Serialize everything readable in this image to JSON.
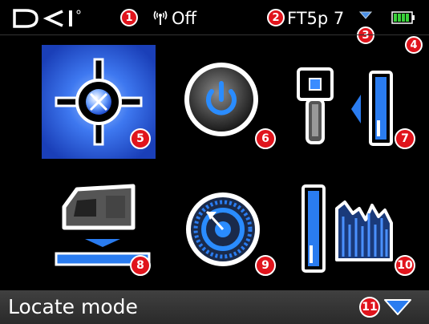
{
  "status": {
    "brand": "DCI",
    "telemetry_label": "Off",
    "frequency_label": "FT5p 7"
  },
  "callouts": [
    "1",
    "2",
    "3",
    "4",
    "5",
    "6",
    "7",
    "8",
    "9",
    "10",
    "11"
  ],
  "menu": {
    "items": [
      {
        "id": "locate",
        "icon": "locate-crosshair-icon",
        "selected": true
      },
      {
        "id": "power",
        "icon": "power-icon",
        "selected": false
      },
      {
        "id": "transmitter",
        "icon": "transmitter-battery-icon",
        "selected": false
      },
      {
        "id": "height",
        "icon": "height-above-ground-icon",
        "selected": false
      },
      {
        "id": "calibration",
        "icon": "calibration-dial-icon",
        "selected": false
      },
      {
        "id": "settings",
        "icon": "settings-bars-icon",
        "selected": false
      }
    ]
  },
  "footer": {
    "mode_label": "Locate mode"
  },
  "colors": {
    "accent": "#2a7cf0",
    "callout": "#e0141c",
    "battery": "#3bd13b",
    "selected_bg": "#1a4fd8"
  }
}
